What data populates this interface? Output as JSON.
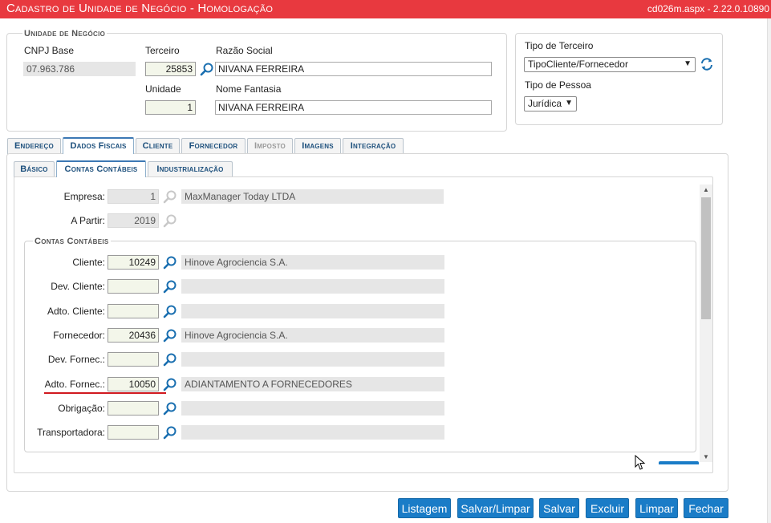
{
  "window": {
    "title": "Cadastro de Unidade de Negócio - Homologação",
    "version": "cd026m.aspx - 2.22.0.10890"
  },
  "unidade": {
    "legend": "Unidade de Negócio",
    "cnpj_label": "CNPJ Base",
    "cnpj_value": "07.963.786",
    "terceiro_label": "Terceiro",
    "terceiro_value": "25853",
    "razao_label": "Razão Social",
    "razao_value": "NIVANA FERREIRA",
    "unidade_label": "Unidade",
    "unidade_value": "1",
    "fantasia_label": "Nome Fantasia",
    "fantasia_value": "NIVANA FERREIRA"
  },
  "tipo": {
    "terceiro_label": "Tipo de Terceiro",
    "terceiro_value": "TipoCliente/Fornecedor",
    "pessoa_label": "Tipo de Pessoa",
    "pessoa_value": "Jurídica"
  },
  "tabs": [
    {
      "label": "Endereço"
    },
    {
      "label": "Dados Fiscais"
    },
    {
      "label": "Cliente"
    },
    {
      "label": "Fornecedor"
    },
    {
      "label": "Imposto"
    },
    {
      "label": "Imagens"
    },
    {
      "label": "Integração"
    }
  ],
  "subtabs": [
    {
      "label": "Básico"
    },
    {
      "label": "Contas Contábeis"
    },
    {
      "label": "Industrialização"
    }
  ],
  "empresa": {
    "label": "Empresa:",
    "code": "1",
    "name": "MaxManager Today LTDA"
  },
  "apartir": {
    "label": "A Partir:",
    "value": "2019"
  },
  "contas": {
    "legend": "Contas Contábeis",
    "rows": [
      {
        "label": "Cliente:",
        "code": "10249",
        "desc": "Hinove Agrociencia S.A."
      },
      {
        "label": "Dev. Cliente:",
        "code": "",
        "desc": ""
      },
      {
        "label": "Adto. Cliente:",
        "code": "",
        "desc": ""
      },
      {
        "label": "Fornecedor:",
        "code": "20436",
        "desc": "Hinove Agrociencia S.A."
      },
      {
        "label": "Dev. Fornec.:",
        "code": "",
        "desc": ""
      },
      {
        "label": "Adto. Fornec.:",
        "code": "10050",
        "desc": "ADIANTAMENTO A FORNECEDORES"
      },
      {
        "label": "Obrigação:",
        "code": "",
        "desc": ""
      },
      {
        "label": "Transportadora:",
        "code": "",
        "desc": ""
      }
    ]
  },
  "buttons": {
    "listagem": "Listagem",
    "salvar_limpar": "Salvar/Limpar",
    "salvar": "Salvar",
    "excluir": "Excluir",
    "limpar": "Limpar",
    "fechar": "Fechar"
  },
  "colors": {
    "title_bar": "#e8393f",
    "button": "#1a7cc7",
    "tab_text": "#1c4f7c",
    "highlight_line": "#d0191f"
  }
}
